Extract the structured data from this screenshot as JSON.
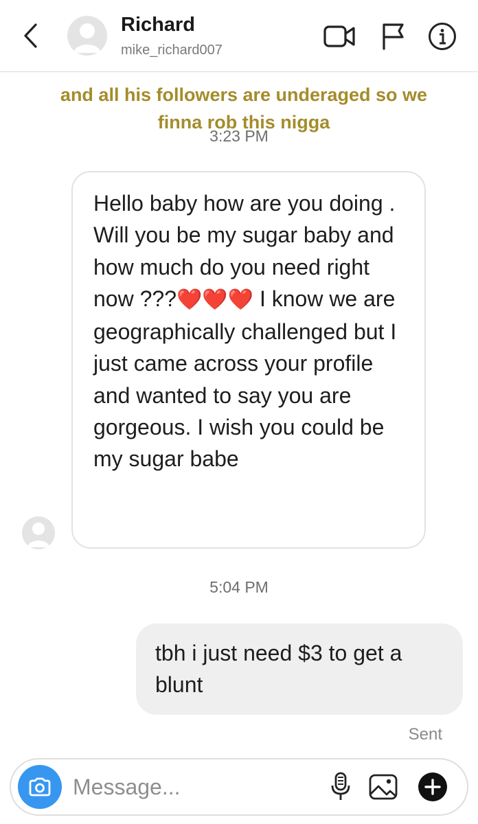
{
  "header": {
    "title": "Richard",
    "username": "mike_richard007"
  },
  "caption": {
    "line1": "and all his followers are underaged so we",
    "line2": "finna rob this nigga"
  },
  "messages": [
    {
      "direction": "incoming",
      "timestamp": "3:23 PM",
      "text_before_hearts": "Hello baby how are you doing . Will you be my sugar baby and how much do you need right now ???",
      "hearts": "❤️❤️❤️",
      "text_after_hearts": "I know we are geographically challenged but I just came across your profile and wanted to say you are gorgeous. I wish you could be my sugar babe"
    },
    {
      "direction": "outgoing",
      "timestamp": "5:04 PM",
      "text": "tbh i just need $3 to get a blunt",
      "status": "Sent"
    }
  ],
  "composer": {
    "placeholder": "Message..."
  },
  "colors": {
    "accent": "#3797f0",
    "caption": "#a48c2c",
    "heart": "#e8192c"
  },
  "icons": [
    "back-chevron-icon",
    "video-call-icon",
    "flag-icon",
    "info-icon",
    "camera-icon",
    "microphone-icon",
    "gallery-icon",
    "plus-icon"
  ]
}
